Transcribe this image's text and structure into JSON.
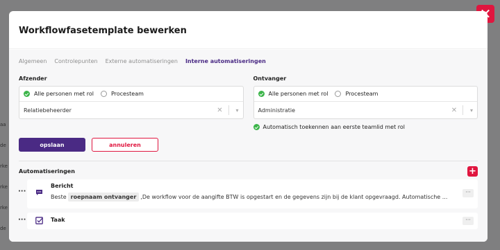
{
  "modal": {
    "title": "Workflowfasetemplate bewerken",
    "close_icon": "close-icon"
  },
  "tabs": [
    {
      "label": "Algemeen",
      "active": false
    },
    {
      "label": "Controlepunten",
      "active": false
    },
    {
      "label": "Externe automatiseringen",
      "active": false
    },
    {
      "label": "Interne automatiseringen",
      "active": true
    }
  ],
  "sender": {
    "label": "Afzender",
    "option_all": "Alle personen met rol",
    "option_team": "Procesteam",
    "selected_option": "Alle personen met rol",
    "select_value": "Relatiebeheerder"
  },
  "receiver": {
    "label": "Ontvanger",
    "option_all": "Alle personen met rol",
    "option_team": "Procesteam",
    "selected_option": "Alle personen met rol",
    "select_value": "Administratie",
    "auto_assign": "Automatisch toekennen aan eerste teamlid met rol"
  },
  "buttons": {
    "save": "opslaan",
    "cancel": "annuleren"
  },
  "automations": {
    "title": "Automatiseringen",
    "items": [
      {
        "title": "Bericht",
        "icon": "message-icon",
        "text_before": "Beste",
        "tag": "roepnaam ontvanger",
        "text_after": ",De workflow voor de aangifte BTW is opgestart en de gegevens zijn bij de klant opgevraagd. Automatische ..."
      },
      {
        "title": "Taak",
        "icon": "task-checkbox-icon"
      }
    ]
  },
  "colors": {
    "primary": "#4a2a84",
    "danger": "#e0163f",
    "success": "#3cb54a"
  }
}
